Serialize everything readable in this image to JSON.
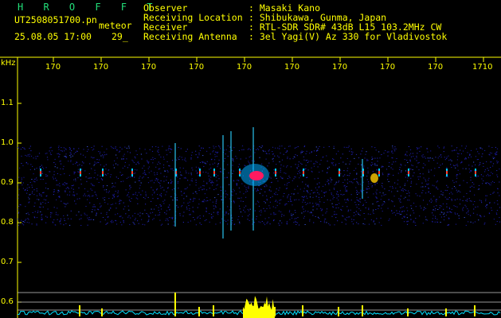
{
  "title": "H R O F F T",
  "file_name": "UT2508051700.pn",
  "category": "meteor",
  "date_time": "25.08.05 17:00",
  "count": "29_",
  "info": [
    {
      "label": "Observer",
      "value": ": Masaki Kano"
    },
    {
      "label": "Receiving Location",
      "value": ": Shibukawa, Gunma, Japan"
    },
    {
      "label": "Receiver",
      "value": ": RTL-SDR SDR# 43dB L15 103.2MHz CW"
    },
    {
      "label": "Receiving Antenna",
      "value": ": 3el Yagi(V) Az 330 for Vladivostok"
    }
  ],
  "y_unit": "kHz",
  "time_ticks": [
    "170",
    "170",
    "170",
    "170",
    "170",
    "170",
    "170",
    "170",
    "170",
    "1710"
  ],
  "freq_ticks": [
    "1.1",
    "1.0",
    "0.9",
    "0.8",
    "0.7",
    "0.6"
  ],
  "colors": {
    "background": "#000000",
    "noise": "#1a1aa0",
    "text": "#ffff00",
    "trace": "#00e0ff",
    "peak": "#ffff00",
    "brand": "#22e07a"
  }
}
